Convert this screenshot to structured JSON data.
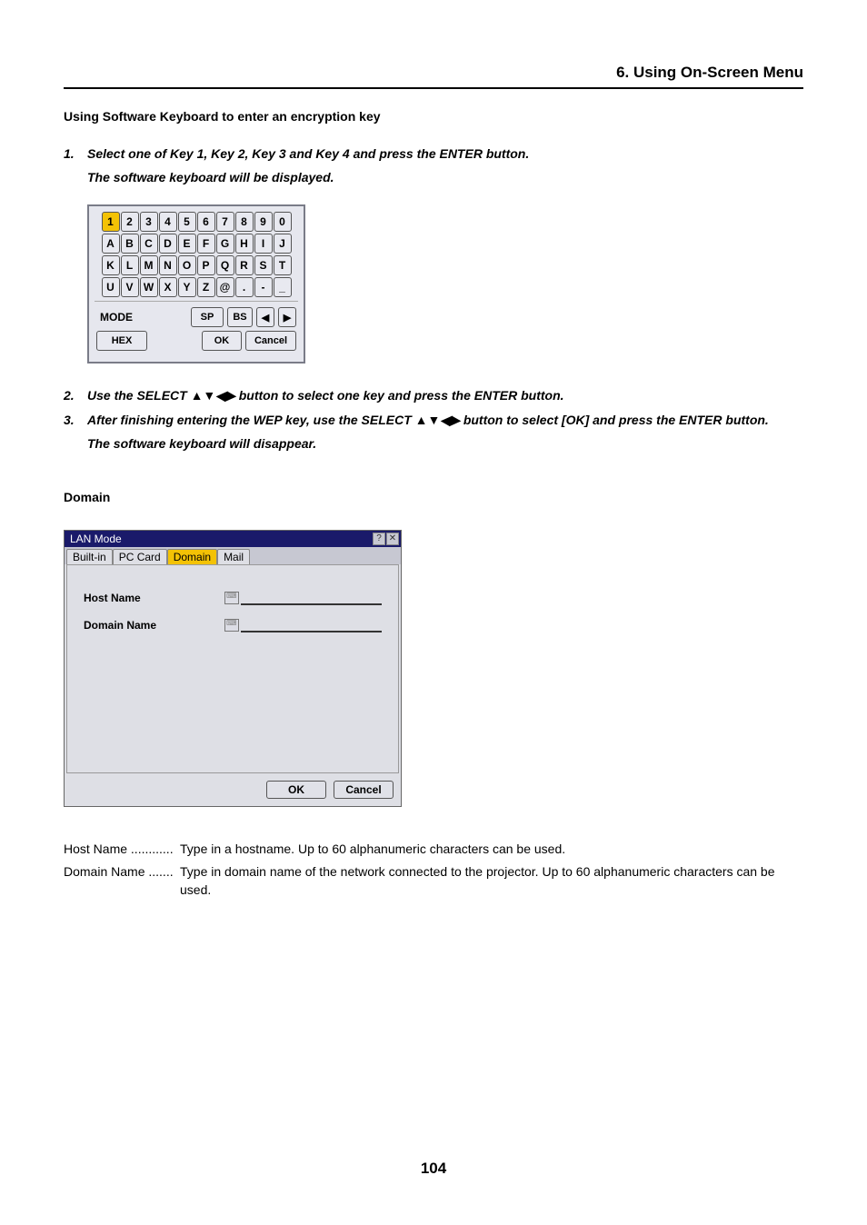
{
  "header": {
    "section": "6. Using On-Screen Menu"
  },
  "subtitle": "Using Software Keyboard to enter an encryption key",
  "steps": {
    "s1a": "Select one of Key 1, Key 2, Key 3 and Key 4 and press the ENTER button.",
    "s1b": "The software keyboard will be displayed.",
    "s2": "Use the SELECT ▲▼◀▶  button to select one key and press the ENTER button.",
    "s3a": "After finishing entering the WEP key, use the SELECT ▲▼◀▶ button to select [OK] and press the ENTER button.",
    "s3b": "The software keyboard will disappear."
  },
  "keyboard": {
    "row1": [
      "1",
      "2",
      "3",
      "4",
      "5",
      "6",
      "7",
      "8",
      "9",
      "0"
    ],
    "row2": [
      "A",
      "B",
      "C",
      "D",
      "E",
      "F",
      "G",
      "H",
      "I",
      "J"
    ],
    "row3": [
      "K",
      "L",
      "M",
      "N",
      "O",
      "P",
      "Q",
      "R",
      "S",
      "T"
    ],
    "row4": [
      "U",
      "V",
      "W",
      "X",
      "Y",
      "Z",
      "@",
      ".",
      "-",
      "_"
    ],
    "mode": "MODE",
    "sp": "SP",
    "bs": "BS",
    "left": "◀",
    "right": "▶",
    "hex": "HEX",
    "ok": "OK",
    "cancel": "Cancel"
  },
  "domain_heading": "Domain",
  "lan": {
    "title": "LAN Mode",
    "tabs": {
      "builtin": "Built-in",
      "pccard": "PC Card",
      "domain": "Domain",
      "mail": "Mail"
    },
    "host_label": "Host Name",
    "domain_label": "Domain Name",
    "ok": "OK",
    "cancel": "Cancel"
  },
  "defs": {
    "host_term": "Host Name ............",
    "host_desc": "Type in a hostname. Up to 60 alphanumeric characters can be used.",
    "domain_term": "Domain Name .......",
    "domain_desc": "Type in domain name of the network connected to the projector. Up to 60 alphanumeric characters can be used."
  },
  "page_number": "104"
}
